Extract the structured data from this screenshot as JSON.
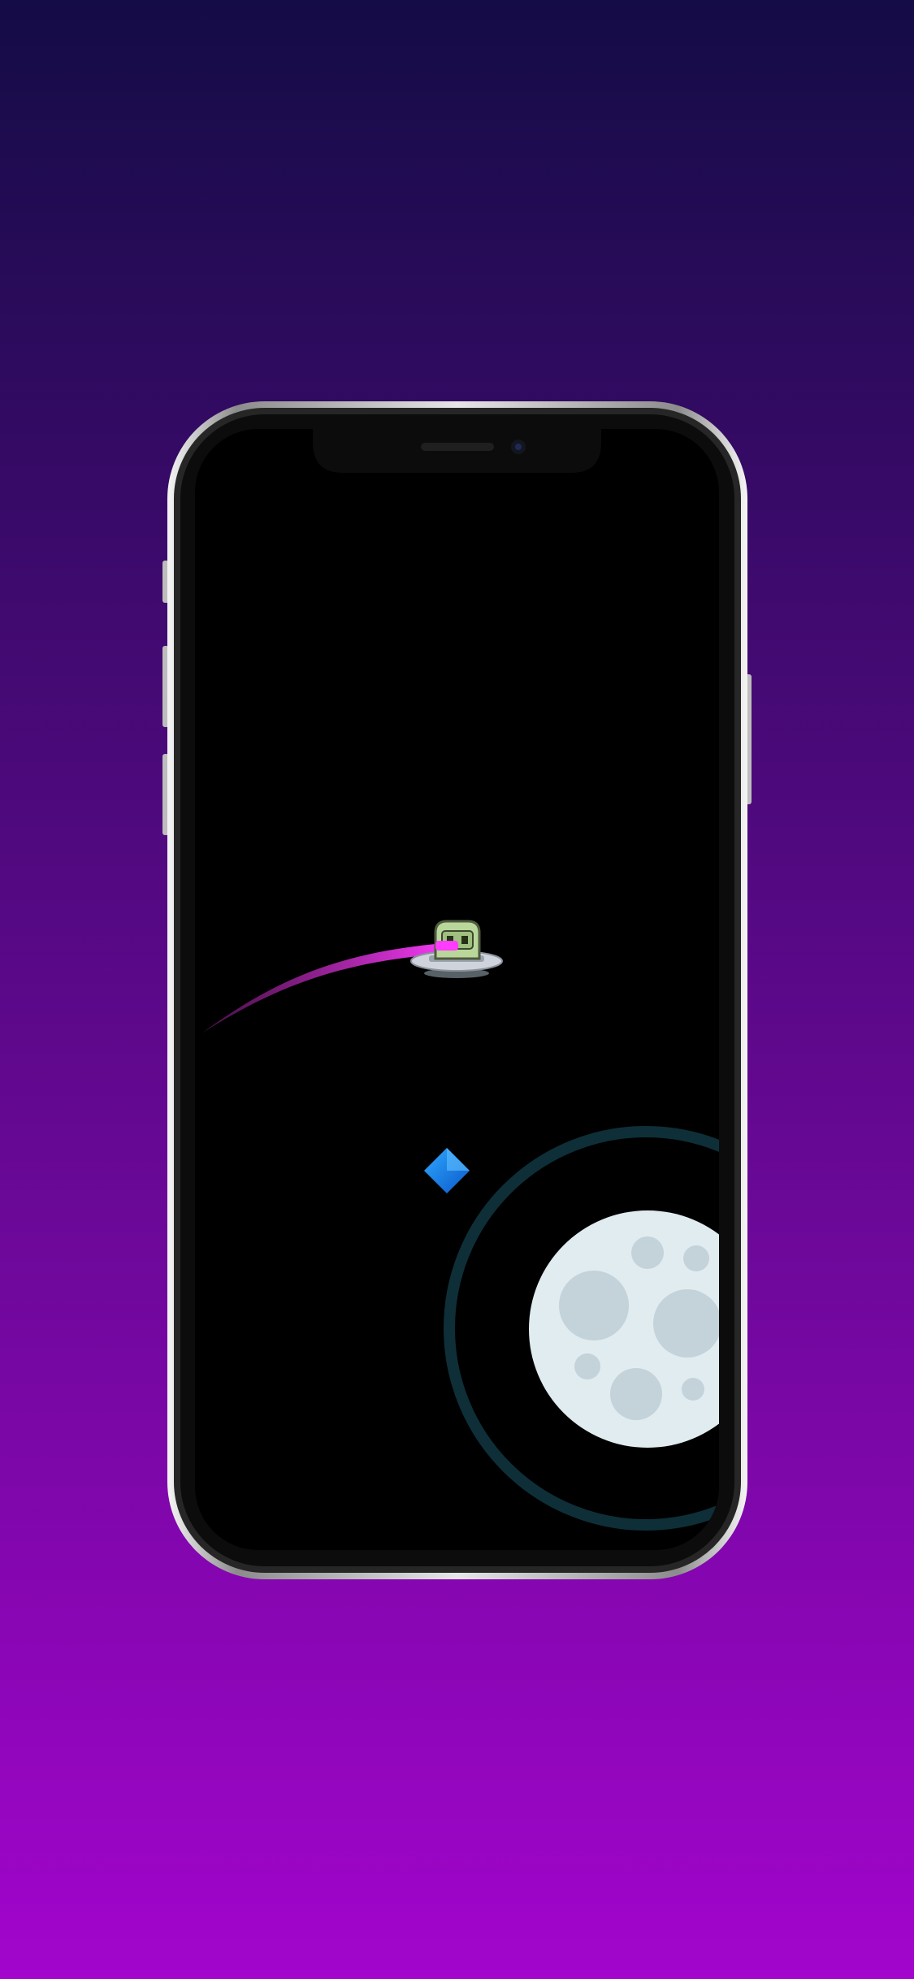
{
  "colors": {
    "background_top": "#140c46",
    "background_bottom": "#a205cc",
    "phone_frame_outer": "#d9d9d9",
    "phone_frame_inner": "#1a1a1a",
    "screen": "#000000",
    "trail_start": "#ff3cff",
    "trail_end": "#7a1a7a",
    "orbit_ring": "#0e2f38",
    "moon": "#e1ecf0",
    "moon_craters": "#c3d3d9",
    "diamond_light": "#2fa8ff",
    "diamond_dark": "#0a59c9",
    "ufo_dome": "#b9d79a",
    "ufo_saucer": "#cfd4dc"
  },
  "game": {
    "player": "ufo-with-alien",
    "pickup": "blue-diamond",
    "planet": "moon",
    "orbit": "ring-around-moon"
  }
}
